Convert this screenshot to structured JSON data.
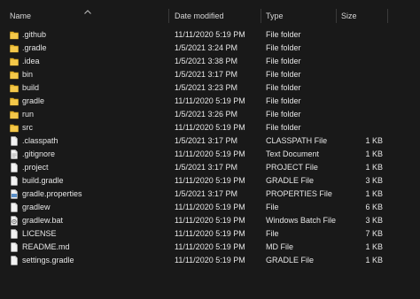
{
  "columns": {
    "name": "Name",
    "date_modified": "Date modified",
    "type": "Type",
    "size": "Size"
  },
  "colors": {
    "folder": "#e8b931",
    "file": "#f2f2f2",
    "background": "#191919"
  },
  "files": [
    {
      "name": ".github",
      "date": "11/11/2020 5:19 PM",
      "type": "File folder",
      "size": "",
      "icon": "folder-icon"
    },
    {
      "name": ".gradle",
      "date": "1/5/2021 3:24 PM",
      "type": "File folder",
      "size": "",
      "icon": "folder-icon"
    },
    {
      "name": ".idea",
      "date": "1/5/2021 3:38 PM",
      "type": "File folder",
      "size": "",
      "icon": "folder-icon"
    },
    {
      "name": "bin",
      "date": "1/5/2021 3:17 PM",
      "type": "File folder",
      "size": "",
      "icon": "folder-icon"
    },
    {
      "name": "build",
      "date": "1/5/2021 3:23 PM",
      "type": "File folder",
      "size": "",
      "icon": "folder-icon"
    },
    {
      "name": "gradle",
      "date": "11/11/2020 5:19 PM",
      "type": "File folder",
      "size": "",
      "icon": "folder-icon"
    },
    {
      "name": "run",
      "date": "1/5/2021 3:26 PM",
      "type": "File folder",
      "size": "",
      "icon": "folder-icon"
    },
    {
      "name": "src",
      "date": "11/11/2020 5:19 PM",
      "type": "File folder",
      "size": "",
      "icon": "folder-icon"
    },
    {
      "name": ".classpath",
      "date": "1/5/2021 3:17 PM",
      "type": "CLASSPATH File",
      "size": "1 KB",
      "icon": "file-icon"
    },
    {
      "name": ".gitignore",
      "date": "11/11/2020 5:19 PM",
      "type": "Text Document",
      "size": "1 KB",
      "icon": "text-file-icon"
    },
    {
      "name": ".project",
      "date": "1/5/2021 3:17 PM",
      "type": "PROJECT File",
      "size": "1 KB",
      "icon": "file-icon"
    },
    {
      "name": "build.gradle",
      "date": "11/11/2020 5:19 PM",
      "type": "GRADLE File",
      "size": "3 KB",
      "icon": "file-icon"
    },
    {
      "name": "gradle.properties",
      "date": "1/5/2021 3:17 PM",
      "type": "PROPERTIES File",
      "size": "1 KB",
      "icon": "properties-file-icon"
    },
    {
      "name": "gradlew",
      "date": "11/11/2020 5:19 PM",
      "type": "File",
      "size": "6 KB",
      "icon": "file-icon"
    },
    {
      "name": "gradlew.bat",
      "date": "11/11/2020 5:19 PM",
      "type": "Windows Batch File",
      "size": "3 KB",
      "icon": "batch-file-icon"
    },
    {
      "name": "LICENSE",
      "date": "11/11/2020 5:19 PM",
      "type": "File",
      "size": "7 KB",
      "icon": "file-icon"
    },
    {
      "name": "README.md",
      "date": "11/11/2020 5:19 PM",
      "type": "MD File",
      "size": "1 KB",
      "icon": "file-icon"
    },
    {
      "name": "settings.gradle",
      "date": "11/11/2020 5:19 PM",
      "type": "GRADLE File",
      "size": "1 KB",
      "icon": "file-icon"
    }
  ]
}
